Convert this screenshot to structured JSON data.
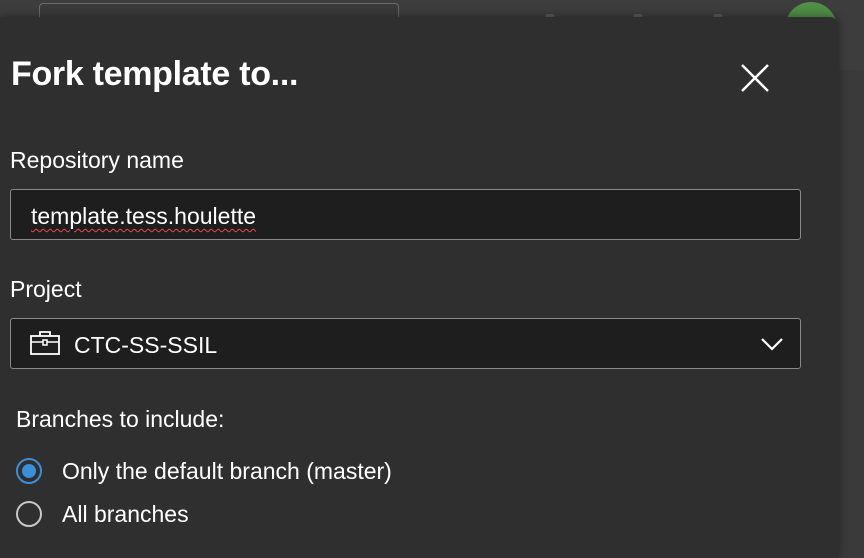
{
  "dialog": {
    "title": "Fork template to...",
    "close_icon": "close-icon"
  },
  "repository": {
    "label": "Repository name",
    "value": "template.tess.houlette"
  },
  "project": {
    "label": "Project",
    "value": "CTC-SS-SSIL",
    "icon": "briefcase-icon"
  },
  "branches": {
    "label": "Branches to include:",
    "options": [
      {
        "label": "Only the default branch (master)",
        "selected": true
      },
      {
        "label": "All branches",
        "selected": false
      }
    ]
  },
  "colors": {
    "accent": "#3b8fd9",
    "dialog_bg": "#2f2f2f",
    "field_bg": "#1e1e1e"
  }
}
